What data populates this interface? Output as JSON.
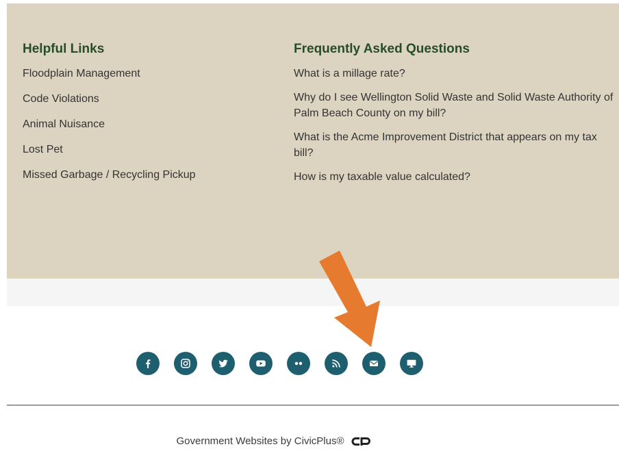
{
  "helpful_links": {
    "heading": "Helpful Links",
    "items": [
      "Floodplain Management",
      "Code Violations",
      "Animal Nuisance",
      "Lost Pet",
      "Missed Garbage / Recycling Pickup"
    ]
  },
  "faq": {
    "heading": "Frequently Asked Questions",
    "items": [
      "What is a millage rate?",
      "Why do I see Wellington Solid Waste and Solid Waste Authority of Palm Beach County on my bill?",
      "What is the Acme Improvement District that appears on my tax bill?",
      "How is my taxable value calculated?"
    ]
  },
  "social_icons": [
    "facebook-icon",
    "instagram-icon",
    "twitter-icon",
    "youtube-icon",
    "flickr-icon",
    "rss-icon",
    "email-icon",
    "monitor-icon"
  ],
  "footer": {
    "text": "Government Websites by CivicPlus®"
  },
  "colors": {
    "panel_bg": "#dcd4c0",
    "heading": "#264d26",
    "social_circle": "#1e5f6f",
    "annotation_arrow": "#e67a2e"
  }
}
